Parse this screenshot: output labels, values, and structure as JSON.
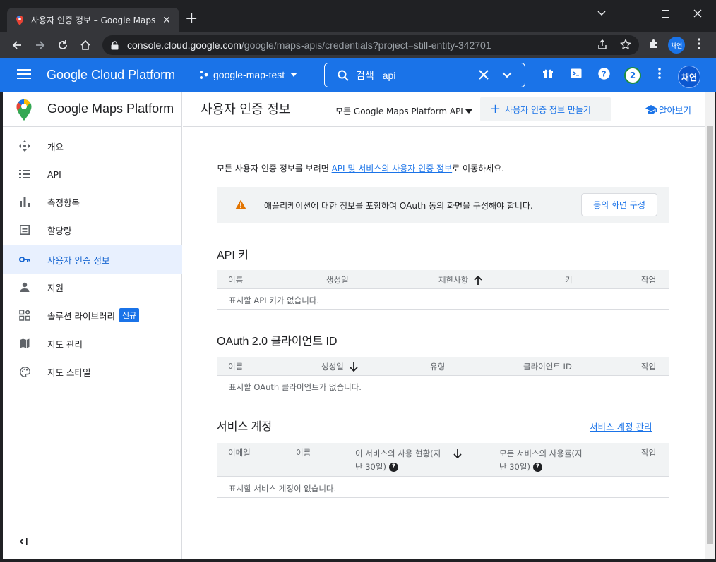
{
  "browser": {
    "tab_title": "사용자 인증 정보 – Google Maps",
    "url_host": "console.cloud.google.com",
    "url_path": "/google/maps-apis/credentials?project=still-entity-342701",
    "profile_label": "채연"
  },
  "header": {
    "title": "Google Cloud Platform",
    "project": "google-map-test",
    "search_label": "검색",
    "search_value": "api",
    "notification_count": "2",
    "avatar_label": "채연"
  },
  "sidebar": {
    "product_name": "Google Maps Platform",
    "items": [
      {
        "label": "개요",
        "icon": "overview-icon"
      },
      {
        "label": "API",
        "icon": "list-icon"
      },
      {
        "label": "측정항목",
        "icon": "bar-chart-icon"
      },
      {
        "label": "할당량",
        "icon": "quota-icon"
      },
      {
        "label": "사용자 인증 정보",
        "icon": "key-icon",
        "active": true
      },
      {
        "label": "지원",
        "icon": "person-icon"
      },
      {
        "label": "솔루션 라이브러리",
        "icon": "solutions-icon",
        "badge": "신규"
      },
      {
        "label": "지도 관리",
        "icon": "map-icon"
      },
      {
        "label": "지도 스타일",
        "icon": "palette-icon"
      }
    ]
  },
  "content": {
    "title": "사용자 인증 정보",
    "api_filter": "모든 Google Maps Platform API",
    "create_button": "사용자 인증 정보 만들기",
    "learn_link": "알아보기",
    "intro_prefix": "모든 사용자 인증 정보를 보려면 ",
    "intro_link": "API 및 서비스의 사용자 인증 정보",
    "intro_suffix": "로 이동하세요.",
    "warning_text": "애플리케이션에 대한 정보를 포함하여 OAuth 동의 화면을 구성해야 합니다.",
    "consent_button": "동의 화면 구성"
  },
  "api_keys": {
    "title": "API 키",
    "columns": [
      "이름",
      "생성일",
      "제한사항",
      "키",
      "작업"
    ],
    "empty": "표시할 API 키가 없습니다."
  },
  "oauth": {
    "title": "OAuth 2.0 클라이언트 ID",
    "columns": [
      "이름",
      "생성일",
      "유형",
      "클라이언트 ID",
      "작업"
    ],
    "empty": "표시할 OAuth 클라이언트가 없습니다."
  },
  "service_accounts": {
    "title": "서비스 계정",
    "manage_link": "서비스 계정 관리",
    "columns": [
      "이메일",
      "이름",
      "이 서비스의 사용 현황(지",
      "난 30일)",
      "모든 서비스의 사용률(지",
      "난 30일)",
      "작업"
    ],
    "empty": "표시할 서비스 계정이 없습니다."
  }
}
